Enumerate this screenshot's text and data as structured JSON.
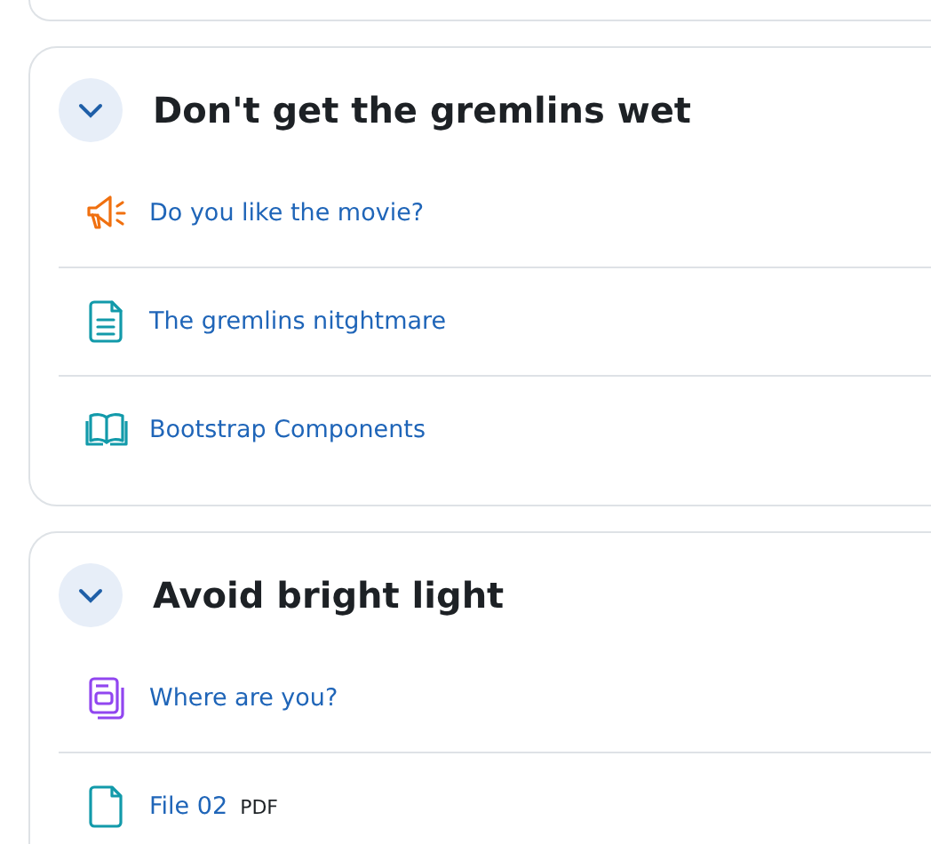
{
  "sections": [
    {
      "title": "Don't get the gremlins wet",
      "expanded": true,
      "items": [
        {
          "kind": "forum",
          "label": "Do you like the movie?"
        },
        {
          "kind": "page",
          "label": "The gremlins nitghtmare"
        },
        {
          "kind": "book",
          "label": "Bootstrap Components"
        }
      ]
    },
    {
      "title": "Avoid bright light",
      "expanded": true,
      "items": [
        {
          "kind": "glossary",
          "label": "Where are you?"
        },
        {
          "kind": "file",
          "label": "File 02",
          "filetype": "PDF"
        }
      ]
    }
  ]
}
